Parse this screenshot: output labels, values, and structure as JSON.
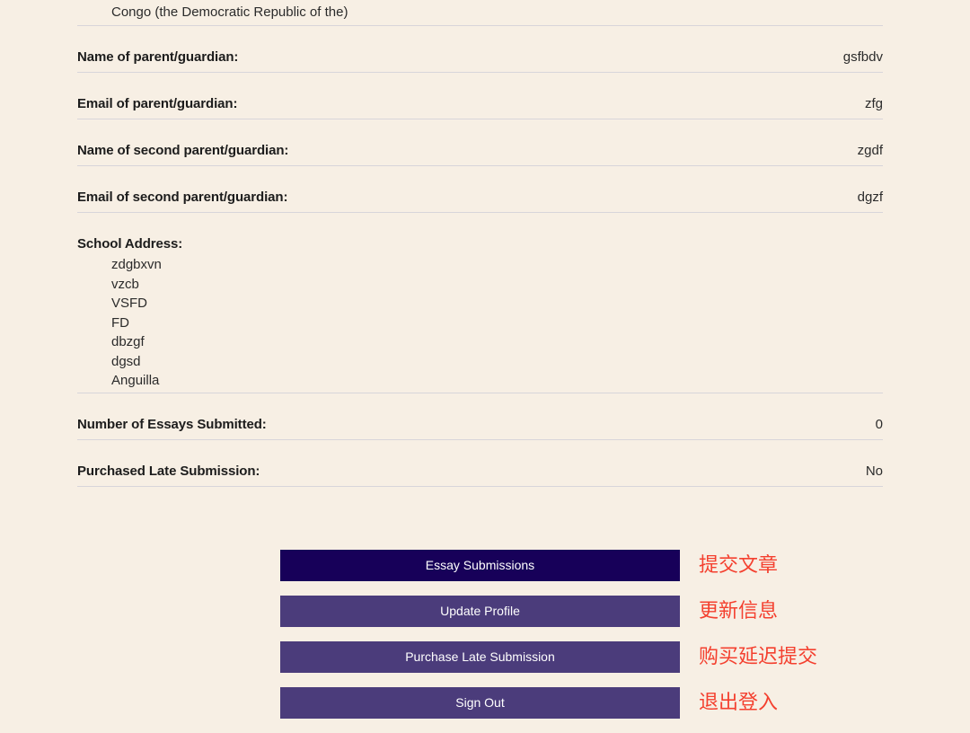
{
  "colors": {
    "background": "#f7efe4",
    "divider": "#d8d5da",
    "label_text": "#1c1c1c",
    "value_text": "#2b2b2b",
    "button_primary": "#170059",
    "button_secondary": "#4b3c7b",
    "button_text": "#ffffff",
    "annotation_red": "#f4402f"
  },
  "profile": {
    "country_value": "Congo (the Democratic Republic of the)",
    "rows": [
      {
        "label": "Name of parent/guardian:",
        "value": "gsfbdv"
      },
      {
        "label": "Email of parent/guardian:",
        "value": "zfg"
      },
      {
        "label": "Name of second parent/guardian:",
        "value": "zgdf"
      },
      {
        "label": "Email of second parent/guardian:",
        "value": "dgzf"
      }
    ],
    "address": {
      "label": "School Address:",
      "lines": [
        "zdgbxvn",
        "vzcb",
        "VSFD",
        "FD",
        "dbzgf",
        "dgsd",
        "Anguilla"
      ]
    },
    "rows_after": [
      {
        "label": "Number of Essays Submitted:",
        "value": "0"
      },
      {
        "label": "Purchased Late Submission:",
        "value": "No"
      }
    ]
  },
  "actions": [
    {
      "label": "Essay Submissions",
      "annotation": "提交文章",
      "style": "primary"
    },
    {
      "label": "Update Profile",
      "annotation": "更新信息",
      "style": "secondary"
    },
    {
      "label": "Purchase Late Submission",
      "annotation": "购买延迟提交",
      "style": "secondary"
    },
    {
      "label": "Sign Out",
      "annotation": "退出登入",
      "style": "secondary"
    }
  ]
}
